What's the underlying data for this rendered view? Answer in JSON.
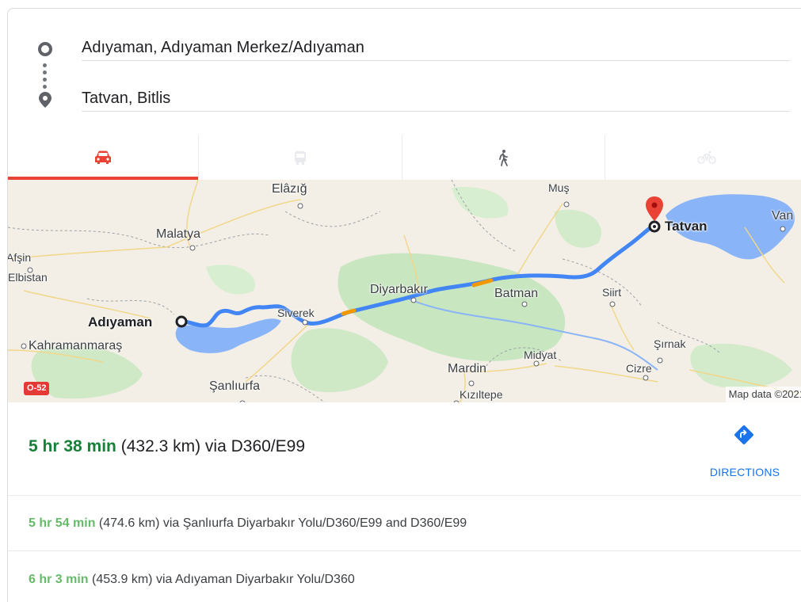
{
  "route": {
    "origin": "Adıyaman, Adıyaman Merkez/Adıyaman",
    "destination": "Tatvan, Bitlis"
  },
  "tabs": [
    {
      "icon": "car-icon",
      "active": true
    },
    {
      "icon": "transit-icon",
      "active": false
    },
    {
      "icon": "walking-icon",
      "active": false
    },
    {
      "icon": "bicycle-icon",
      "active": false
    }
  ],
  "map": {
    "labels": {
      "elazig": "Elâzığ",
      "mus": "Muş",
      "van": "Van",
      "tatvan": "Tatvan",
      "malatya": "Malatya",
      "afsin": "Afşin",
      "elbistan": "Elbistan",
      "diyarbakir": "Diyarbakır",
      "batman": "Batman",
      "siirt": "Siirt",
      "siverek": "Siverek",
      "adiyaman": "Adıyaman",
      "kahramanmaras": "Kahramanmaraş",
      "sirnak": "Şırnak",
      "midyat": "Midyat",
      "mardin": "Mardin",
      "cizre": "Cizre",
      "sanliurfa": "Şanlıurfa",
      "kiziltepe": "Kızıltepe"
    },
    "road_badge": "O-52",
    "attribution": "Map data ©2021",
    "colors": {
      "route": "#4285f4",
      "traffic": "#f29900",
      "land": "#f3efe6",
      "green": "#c8e6c0",
      "water": "#8ab4f8",
      "pin": "#ea4335"
    }
  },
  "primary_route": {
    "duration": "5 hr 38 min",
    "details": " (432.3 km) via D360/E99",
    "directions_label": "DIRECTIONS"
  },
  "alternates": [
    {
      "duration": "5 hr 54 min",
      "details": " (474.6 km) via Şanlıurfa Diyarbakır Yolu/D360/E99 and D360/E99"
    },
    {
      "duration": "6 hr 3 min",
      "details": " (453.9 km) via Adıyaman Diyarbakır Yolu/D360"
    }
  ]
}
